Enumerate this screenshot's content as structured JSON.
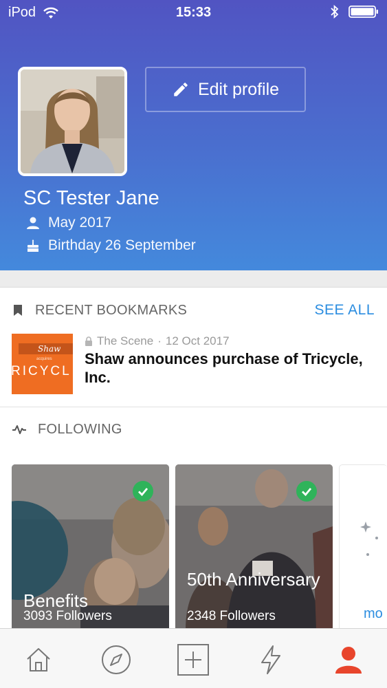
{
  "status_bar": {
    "carrier": "iPod",
    "time": "15:33"
  },
  "profile": {
    "edit_label": "Edit profile",
    "name": "SC Tester Jane",
    "joined": "May 2017",
    "birthday": "Birthday 26 September"
  },
  "bookmarks": {
    "section_title": "RECENT BOOKMARKS",
    "see_all_label": "SEE ALL",
    "item": {
      "thumb_logo": "Shaw",
      "thumb_small": "acquires",
      "thumb_word": "RICYCL",
      "source": "The Scene",
      "date": "12 Oct 2017",
      "title": "Shaw announces purchase of Tricycle, Inc."
    }
  },
  "following": {
    "section_title": "FOLLOWING",
    "cards": [
      {
        "title": "Benefits",
        "followers": "3093 Followers"
      },
      {
        "title": "50th Anniversary",
        "followers": "2348 Followers"
      },
      {
        "partial_text": "mo"
      }
    ]
  },
  "tab_bar": {
    "tabs": [
      "home-icon",
      "compass-icon",
      "add-icon",
      "lightning-icon",
      "profile-icon"
    ],
    "active_color": "#e8452c"
  },
  "colors": {
    "header_gradient_top": "#5154c2",
    "header_gradient_bottom": "#4489dc",
    "link_blue": "#2b8de0",
    "check_green": "#2fb35a",
    "bookmark_thumb_orange": "#ef6d22"
  }
}
